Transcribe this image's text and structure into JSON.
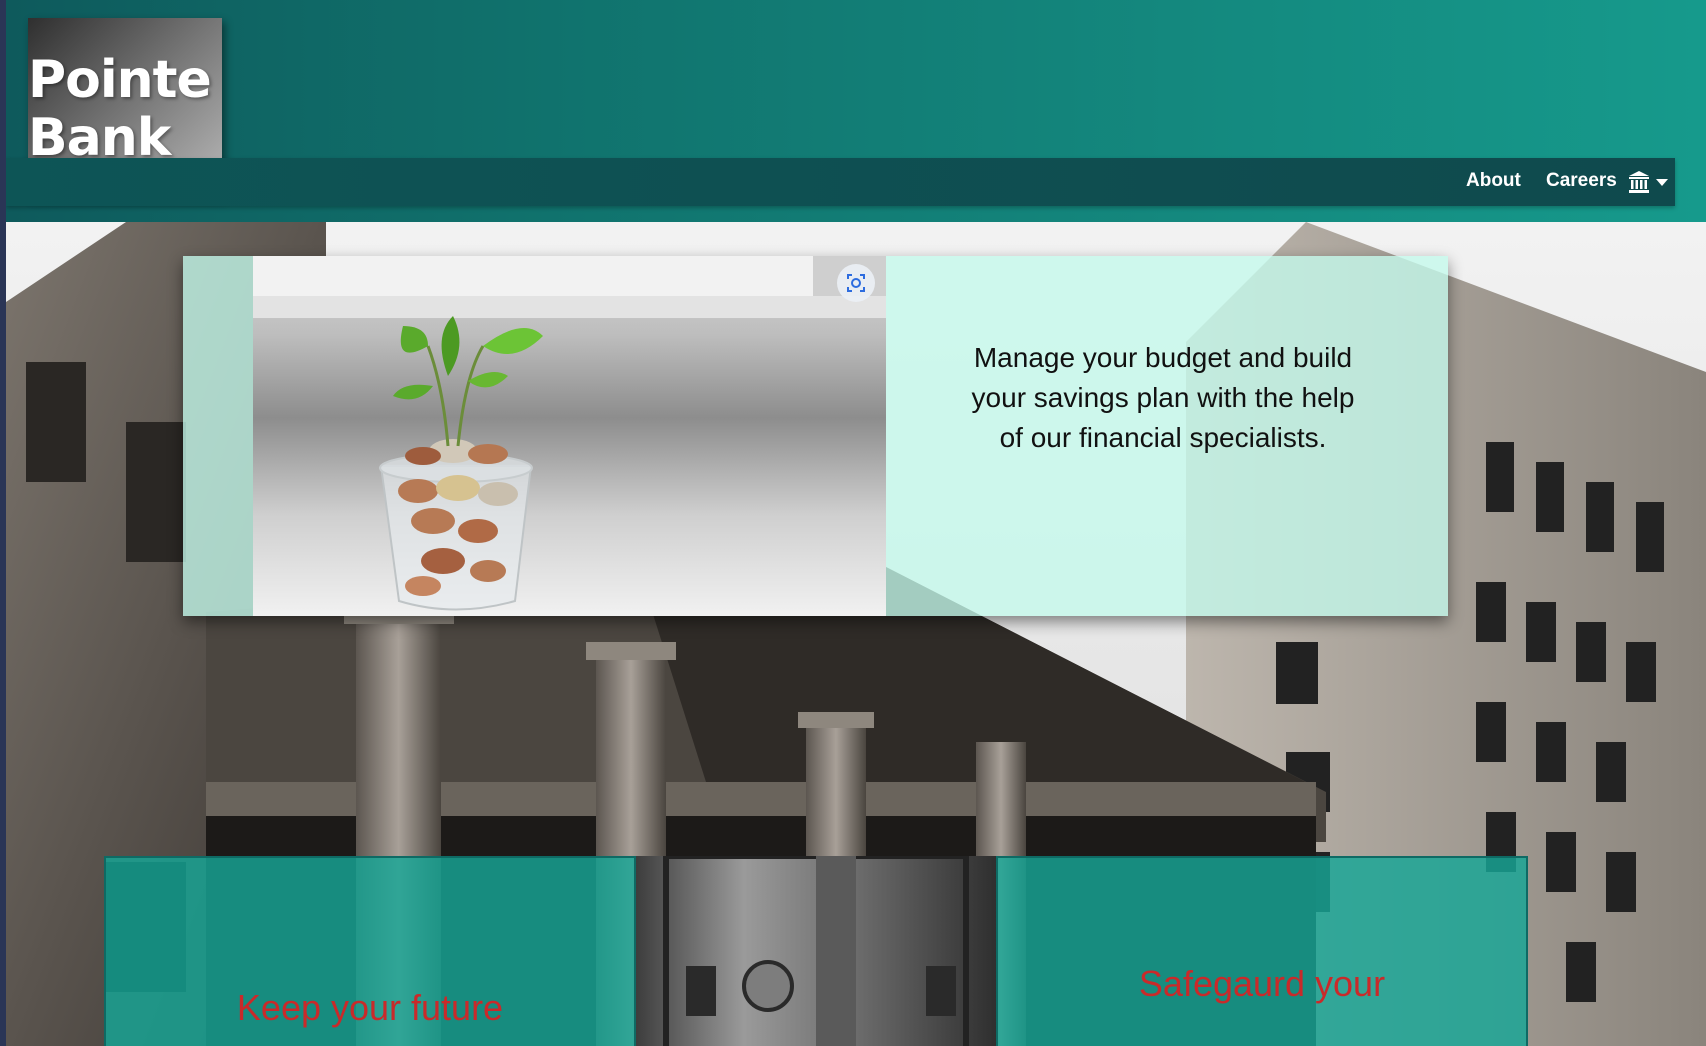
{
  "brand": {
    "line1": "Pointe",
    "line2": "Bank"
  },
  "nav": {
    "about": "About",
    "careers": "Careers",
    "bank_icon": "bank-icon",
    "dropdown_icon": "caret-down-icon"
  },
  "promo": {
    "text": "Manage your budget and build your savings plan with the help of our financial specialists."
  },
  "features": {
    "left_title": "Keep your future",
    "right_title": "Safegaurd your"
  },
  "colors": {
    "header_teal": "#10716c",
    "card_mint": "#c4faec",
    "feature_teal": "#16a696",
    "feature_title": "#c92a2a"
  }
}
